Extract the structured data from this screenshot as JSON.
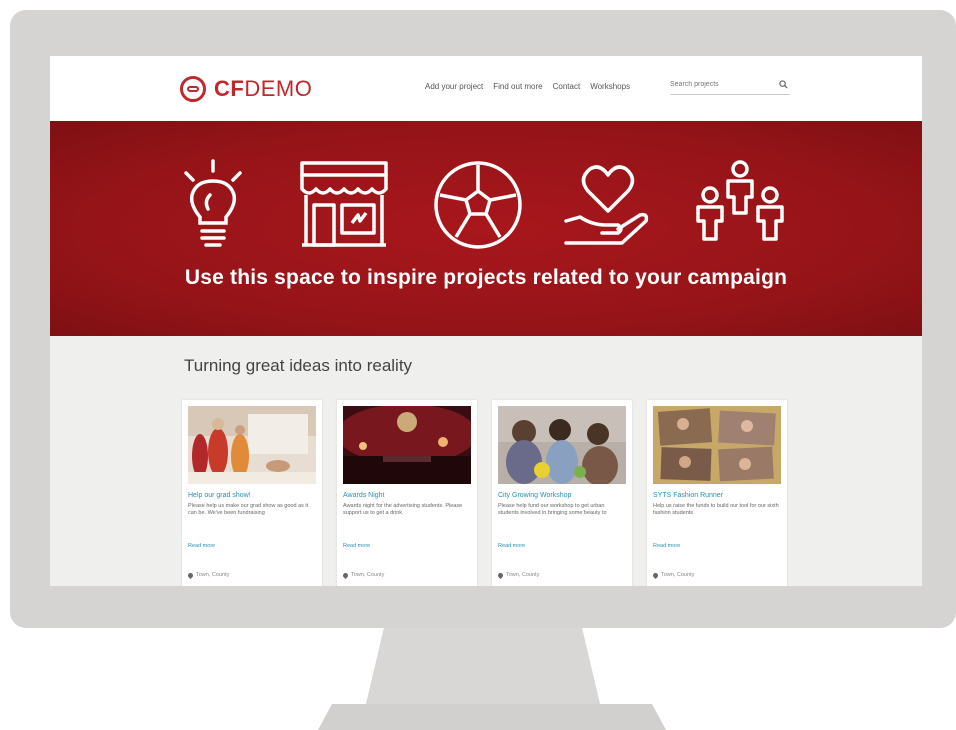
{
  "header": {
    "logo_cf": "CF",
    "logo_demo": "DEMO",
    "nav": [
      "Add your project",
      "Find out more",
      "Contact",
      "Workshops"
    ],
    "search_placeholder": "Search projects",
    "search_icon": "magnifier-icon"
  },
  "hero": {
    "title": "Use this space to inspire projects related to your campaign",
    "icons": [
      "lightbulb-icon",
      "shop-icon",
      "football-icon",
      "heart-hand-icon",
      "people-icon"
    ]
  },
  "section": {
    "title": "Turning great ideas into reality"
  },
  "cards": [
    {
      "title": "Help our grad show!",
      "desc": "Please help us make our grad show as good as it can be. We've been fundraising",
      "link": "Read more",
      "location": "Town, County",
      "image": "fashion-show-photo"
    },
    {
      "title": "Awards Night",
      "desc": "Awards night for the advertising students. Please support us to get a drink",
      "link": "Read more",
      "location": "Town, County",
      "image": "awards-night-photo"
    },
    {
      "title": "City Growing Workshop",
      "desc": "Please help fund our workshop to get urban students involved in bringing some beauty to",
      "link": "Read more",
      "location": "Town, County",
      "image": "workshop-photo"
    },
    {
      "title": "SYTS Fashion Runner",
      "desc": "Help us raise the funds to build our tool for our sixth fashion students",
      "link": "Read more",
      "location": "Town, County",
      "image": "fashion-collage-photo"
    }
  ],
  "colors": {
    "brand_red": "#c0282d",
    "hero_red": "#9a1519",
    "link_blue": "#2a90b0"
  }
}
